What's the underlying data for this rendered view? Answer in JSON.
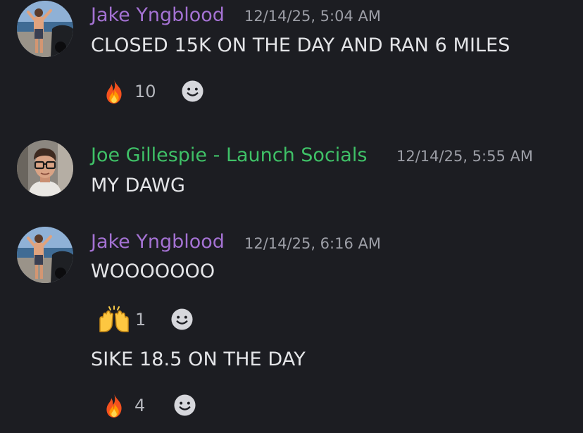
{
  "messages": [
    {
      "author": "Jake Yngblood",
      "timestamp": "12/14/25, 5:04 AM",
      "text": "CLOSED 15K ON THE DAY AND RAN 6 MILES",
      "reaction": {
        "emoji": "fire-icon",
        "count": "10"
      }
    },
    {
      "author": "Joe Gillespie - Launch Socials",
      "timestamp": "12/14/25, 5:55 AM",
      "text": "MY DAWG"
    },
    {
      "author": "Jake Yngblood",
      "timestamp": "12/14/25, 6:16 AM",
      "text": "WOOOOOOO",
      "reaction": {
        "emoji": "raised-hands-icon",
        "count": "1"
      },
      "followup": {
        "text": "SIKE 18.5 ON THE DAY",
        "reaction": {
          "emoji": "fire-icon",
          "count": "4"
        }
      }
    }
  ],
  "colors": {
    "background": "#1c1d22",
    "author_jake": "#a472d3",
    "author_joe": "#3fc167",
    "timestamp": "#9c9ea6",
    "message_text": "#e4e5e8",
    "reaction_count": "#b5b7bd"
  },
  "icons": {
    "fire": "fire-icon",
    "raised_hands": "raised-hands-icon",
    "add_reaction": "smiley-add-reaction-icon"
  }
}
